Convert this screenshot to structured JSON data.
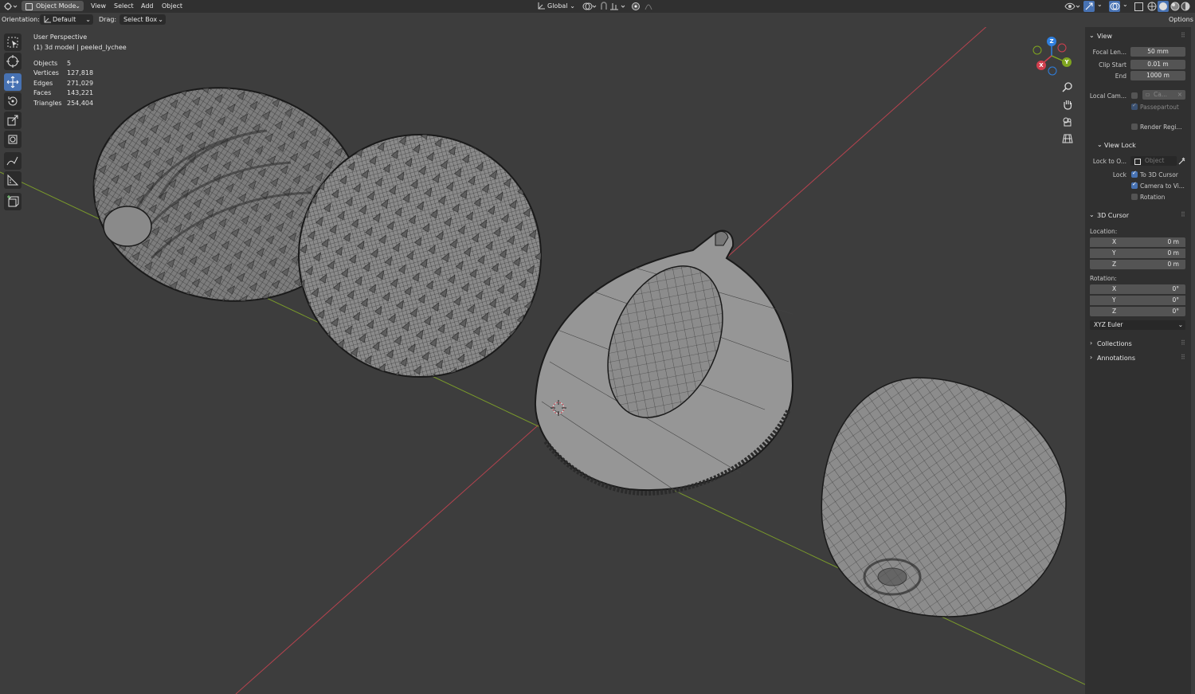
{
  "header": {
    "mode": "Object Mode",
    "menus": [
      "View",
      "Select",
      "Add",
      "Object"
    ],
    "transform_orientation": "Global",
    "options_label": "Options"
  },
  "subheader": {
    "orientation_label": "Orientation:",
    "orientation_value": "Default",
    "drag_label": "Drag:",
    "drag_value": "Select Box"
  },
  "overlay": {
    "view_name": "User Perspective",
    "object_info": "(1) 3d model | peeled_lychee",
    "stats": [
      {
        "label": "Objects",
        "value": "5"
      },
      {
        "label": "Vertices",
        "value": "127,818"
      },
      {
        "label": "Edges",
        "value": "271,029"
      },
      {
        "label": "Faces",
        "value": "143,221"
      },
      {
        "label": "Triangles",
        "value": "254,404"
      }
    ]
  },
  "tools": [
    "select-box",
    "cursor",
    "move",
    "rotate",
    "scale",
    "transform",
    "annotate",
    "measure",
    "add-cube"
  ],
  "active_tool": "move",
  "gizmo": {
    "x": "X",
    "y": "Y",
    "z": "Z"
  },
  "npanel": {
    "view": {
      "title": "View",
      "focal_label": "Focal Len...",
      "focal_value": "50 mm",
      "clip_start_label": "Clip Start",
      "clip_start_value": "0.01 m",
      "clip_end_label": "End",
      "clip_end_value": "1000 m",
      "local_camera_label": "Local Cam...",
      "local_camera_value": "Ca...",
      "passepartout_label": "Passepartout",
      "render_region_label": "Render Regi..."
    },
    "view_lock": {
      "title": "View Lock",
      "lock_to_object_label": "Lock to O...",
      "lock_to_object_placeholder": "Object",
      "lock_label": "Lock",
      "to_3d_cursor_label": "To 3D Cursor",
      "to_3d_cursor_checked": true,
      "camera_to_view_label": "Camera to Vi...",
      "camera_to_view_checked": true,
      "rotation_label": "Rotation",
      "rotation_checked": false
    },
    "cursor": {
      "title": "3D Cursor",
      "location_label": "Location:",
      "loc_x_label": "X",
      "loc_x_value": "0 m",
      "loc_y_label": "Y",
      "loc_y_value": "0 m",
      "loc_z_label": "Z",
      "loc_z_value": "0 m",
      "rotation_label": "Rotation:",
      "rot_x_label": "X",
      "rot_x_value": "0°",
      "rot_y_label": "Y",
      "rot_y_value": "0°",
      "rot_z_label": "Z",
      "rot_z_value": "0°",
      "rotation_mode": "XYZ Euler"
    },
    "collections_title": "Collections",
    "annotations_title": "Annotations"
  },
  "colors": {
    "accent": "#4772b3",
    "axis_x": "#d13f4e",
    "axis_y": "#7fa51f",
    "axis_z": "#2f7fdf",
    "viewport_bg": "#3d3d3d"
  }
}
